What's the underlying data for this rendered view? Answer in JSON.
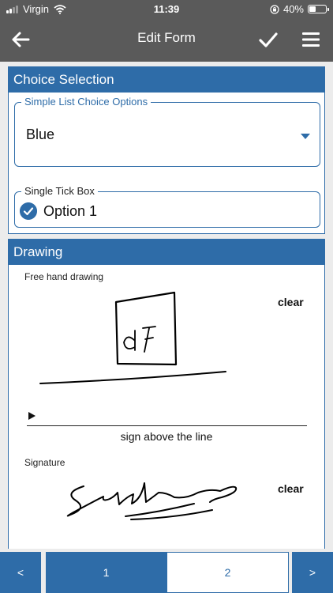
{
  "status_bar": {
    "carrier": "Virgin",
    "time": "11:39",
    "battery": "40%",
    "battery_level": 0.4
  },
  "header": {
    "title": "Edit Form",
    "back_icon": "arrow-left-icon",
    "save_icon": "checkmark-icon",
    "menu_icon": "hamburger-menu-icon"
  },
  "choice_section": {
    "title": "Choice Selection",
    "list_field": {
      "legend": "Simple List Choice Options",
      "value": "Blue"
    },
    "tick_field": {
      "legend": "Single Tick Box",
      "option": "Option 1",
      "checked": true
    }
  },
  "drawing_section": {
    "title": "Drawing",
    "freehand": {
      "label": "Free hand drawing",
      "clear": "clear",
      "sign_hint": "sign above the line"
    },
    "signature": {
      "label": "Signature",
      "clear": "clear"
    }
  },
  "pager": {
    "prev": "<",
    "next": ">",
    "pages": [
      "1",
      "2"
    ],
    "current": "2"
  },
  "colors": {
    "accent": "#2e6ca8",
    "header": "#5a5a5a",
    "background": "#ececec"
  }
}
